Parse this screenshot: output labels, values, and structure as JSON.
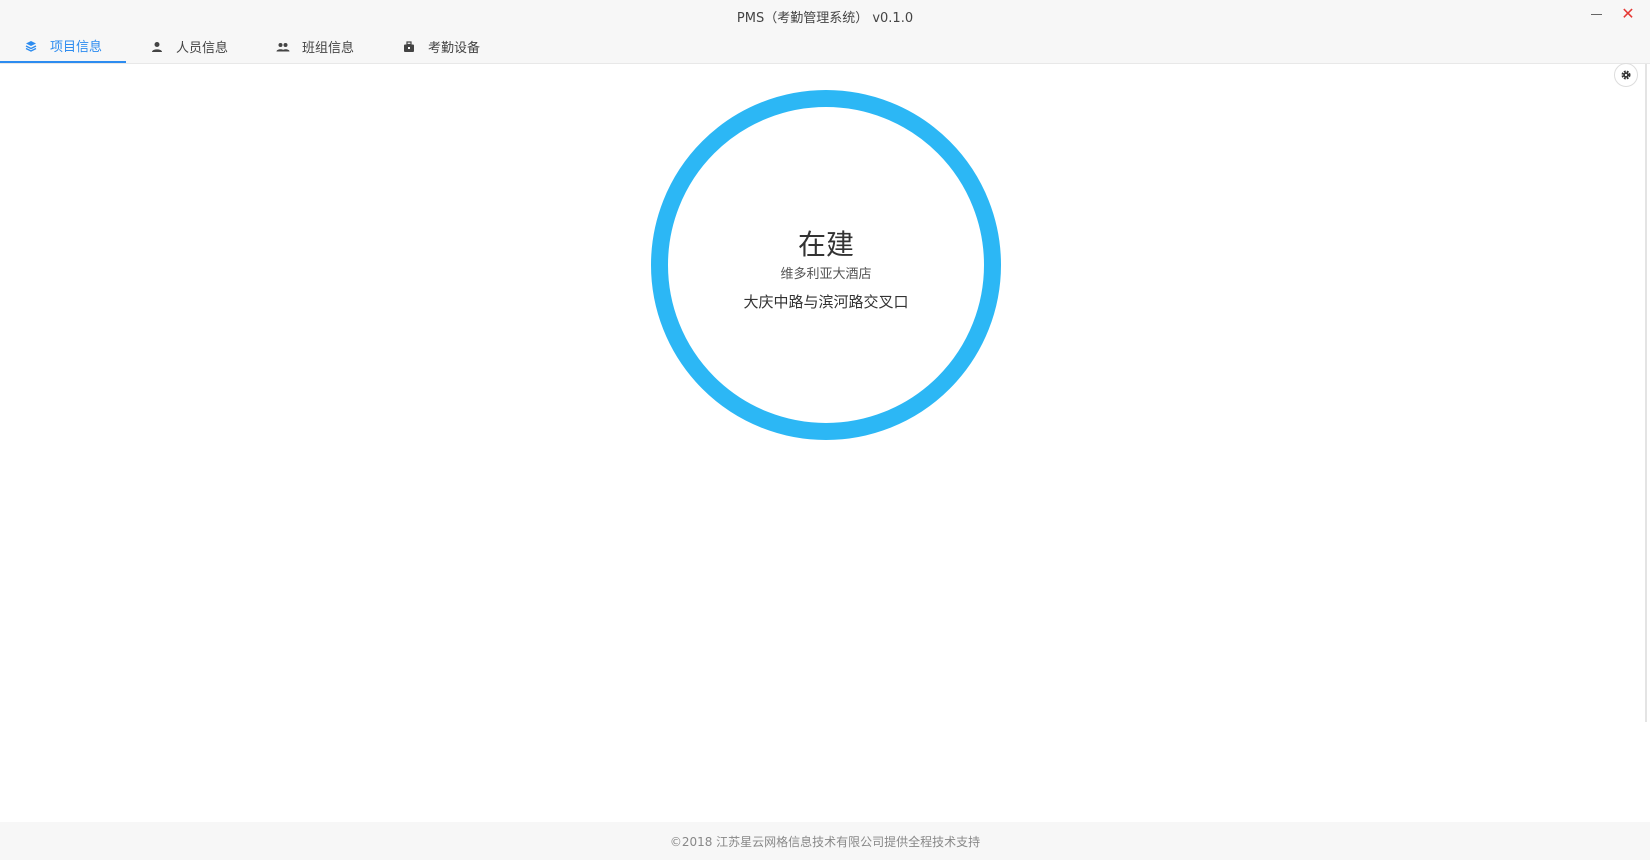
{
  "window": {
    "title": "PMS（考勤管理系统） v0.1.0",
    "accent_color": "#2d8cf0",
    "close_color": "#e53935"
  },
  "tabs": [
    {
      "label": "项目信息",
      "icon": "layers-icon",
      "active": true
    },
    {
      "label": "人员信息",
      "icon": "person-icon",
      "active": false
    },
    {
      "label": "班组信息",
      "icon": "group-icon",
      "active": false
    },
    {
      "label": "考勤设备",
      "icon": "device-icon",
      "active": false
    }
  ],
  "settings": {
    "icon": "gear-icon"
  },
  "project": {
    "status": "在建",
    "name": "维多利亚大酒店",
    "address": "大庆中路与滨河路交叉口",
    "ring_color": "#2cb7f5"
  },
  "footer": {
    "text": "©2018 江苏星云网格信息技术有限公司提供全程技术支持"
  }
}
